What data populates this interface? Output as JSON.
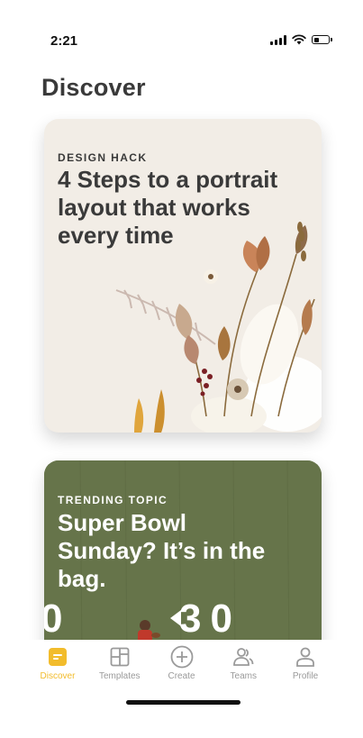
{
  "status_bar": {
    "time": "2:21",
    "battery_level": 0.4
  },
  "page_title": "Discover",
  "cards": [
    {
      "tag": "DESIGN HACK",
      "title": "4 Steps to a portrait layout that works every time"
    },
    {
      "tag": "TRENDING TOPIC",
      "title": "Super Bowl Sunday? It’s in the bag.",
      "yard_marker_left": "0",
      "yard_marker_right": "30"
    }
  ],
  "tabs": [
    {
      "label": "Discover",
      "icon": "discover-icon",
      "active": true
    },
    {
      "label": "Templates",
      "icon": "templates-icon",
      "active": false
    },
    {
      "label": "Create",
      "icon": "create-plus-icon",
      "active": false
    },
    {
      "label": "Teams",
      "icon": "teams-icon",
      "active": false
    },
    {
      "label": "Profile",
      "icon": "profile-icon",
      "active": false
    }
  ],
  "colors": {
    "accent": "#f2bc2c",
    "inactive": "#9a9a9a",
    "field_green": "#66744a",
    "card_cream": "#f2ede6"
  }
}
